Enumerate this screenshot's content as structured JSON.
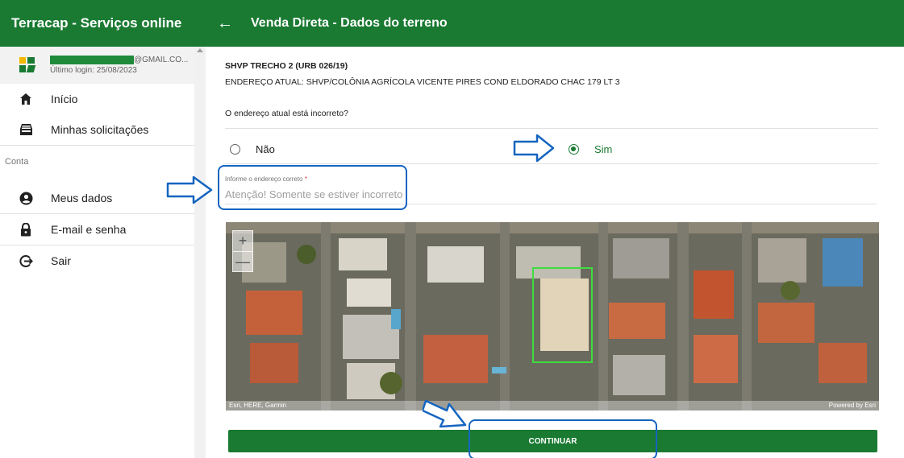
{
  "app": {
    "title": "Terracap - Serviços online"
  },
  "user": {
    "email_suffix": "@GMAIL.CO...",
    "last_login": "Último login: 25/08/2023"
  },
  "sidebar": {
    "items": [
      {
        "label": "Início",
        "icon": "home-icon"
      },
      {
        "label": "Minhas solicitações",
        "icon": "inbox-icon"
      }
    ],
    "section_label": "Conta",
    "account_items": [
      {
        "label": "Meus dados",
        "icon": "account-circle-icon"
      },
      {
        "label": "E-mail e senha",
        "icon": "lock-icon"
      },
      {
        "label": "Sair",
        "icon": "logout-icon"
      }
    ]
  },
  "header": {
    "title": "Venda Direta - Dados do terreno",
    "back_icon": "arrow-left-icon"
  },
  "lot": {
    "title": "SHVP TRECHO 2 (URB 026/19)",
    "address": "ENDEREÇO ATUAL: SHVP/COLÔNIA AGRÍCOLA VICENTE PIRES COND ELDORADO CHAC 179 LT 3"
  },
  "form": {
    "question": "O endereço atual está incorreto?",
    "options": [
      {
        "label": "Não",
        "checked": false
      },
      {
        "label": "Sim",
        "checked": true
      }
    ],
    "field_label": "Informe o endereço correto",
    "field_required_mark": "*",
    "field_placeholder": "Atenção! Somente se estiver incorreto"
  },
  "map": {
    "zoom_in": "+",
    "zoom_out": "—",
    "credits": "Esri, HERE, Garmin",
    "powered_by": "Powered by Esri"
  },
  "actions": {
    "continue_label": "CONTINUAR"
  },
  "colors": {
    "brand_green": "#1a7a32",
    "annotation_blue": "#1565c0"
  }
}
